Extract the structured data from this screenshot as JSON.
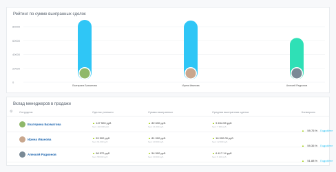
{
  "chart_card": {
    "title": "Рейтинг по сумме выигранных сделок"
  },
  "chart_data": {
    "type": "bar",
    "categories": [
      "Екатерина Бахматова",
      "Ирина Иванова",
      "Алексей Радионов"
    ],
    "values": [
      80000,
      79000,
      54000
    ],
    "y_ticks": [
      "80000",
      "60000",
      "40000",
      "20000",
      "0"
    ],
    "ylim": [
      0,
      80000
    ],
    "colors": [
      "#2fc6f6",
      "#2fc6f6",
      "#2fe0b6"
    ],
    "xlabel": "",
    "ylabel": "",
    "grid": true
  },
  "table_card": {
    "title": "Вклад менеджеров в продажи",
    "columns": [
      "Сотрудник",
      "Сделок успешно",
      "Сумма выигранных",
      "Средняя выигранная сделка",
      "Конверсия"
    ],
    "rows": [
      {
        "name": "Екатерина Бахматова",
        "avatar_color": "#8fb86a",
        "deals": "147 500 руб.",
        "deals_sub": "был: 104 000 руб.",
        "sum": "82 630 руб.",
        "sum_sub": "был: 41 000 руб.",
        "avg": "9 454.55 руб.",
        "avg_sub": "был: 7 900 руб.",
        "conv": "59.75 %",
        "conv_link": "Подробнее"
      },
      {
        "name": "Ирина Иванова",
        "avatar_color": "#c9a78e",
        "deals": "99 500 руб.",
        "deals_sub": "был: 61 000 руб.",
        "sum": "81 000 руб.",
        "sum_sub": "был: 40 000 руб.",
        "avg": "16 090.00 руб.",
        "avg_sub": "был: 12 000 руб.",
        "conv": "59.35 %",
        "conv_link": "Подробнее"
      },
      {
        "name": "Алексей Радионов",
        "avatar_color": "#7a8a96",
        "deals": "98 570 руб.",
        "deals_sub": "был: 58 000 руб.",
        "sum": "54 500 руб.",
        "sum_sub": "был: 30 000 руб.",
        "avg": "6 417.14 руб.",
        "avg_sub": "был: 5 100 руб.",
        "conv": "51.88 %",
        "conv_link": "Подробнее"
      }
    ]
  }
}
